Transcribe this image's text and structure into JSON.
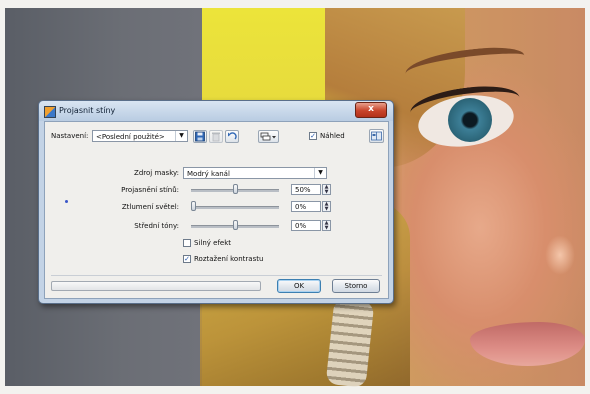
{
  "dialog": {
    "title": "Projasnit stíny",
    "close_label": "x"
  },
  "presets": {
    "label": "Nastavení:",
    "value": "<Poslední použité>"
  },
  "preview": {
    "label": "Náhled",
    "checked": true
  },
  "mask_source": {
    "label": "Zdroj masky:",
    "value": "Modrý kanál"
  },
  "sliders": [
    {
      "label": "Projasnění stínů:",
      "value": "50%",
      "level": 0.5
    },
    {
      "label": "Ztlumení světel:",
      "value": "0%",
      "level": 0.0
    },
    {
      "label": "Střední tóny:",
      "value": "0%",
      "level": 0.5
    }
  ],
  "options": {
    "strong_effect": {
      "label": "Silný efekt",
      "checked": false
    },
    "stretch_contrast": {
      "label": "Roztažení kontrastu",
      "checked": true
    }
  },
  "buttons": {
    "ok": "OK",
    "cancel": "Storno"
  },
  "check_mark": "✓",
  "colors": {
    "dialog_frame": "#c3d3e6",
    "close_button": "#c8432a"
  }
}
